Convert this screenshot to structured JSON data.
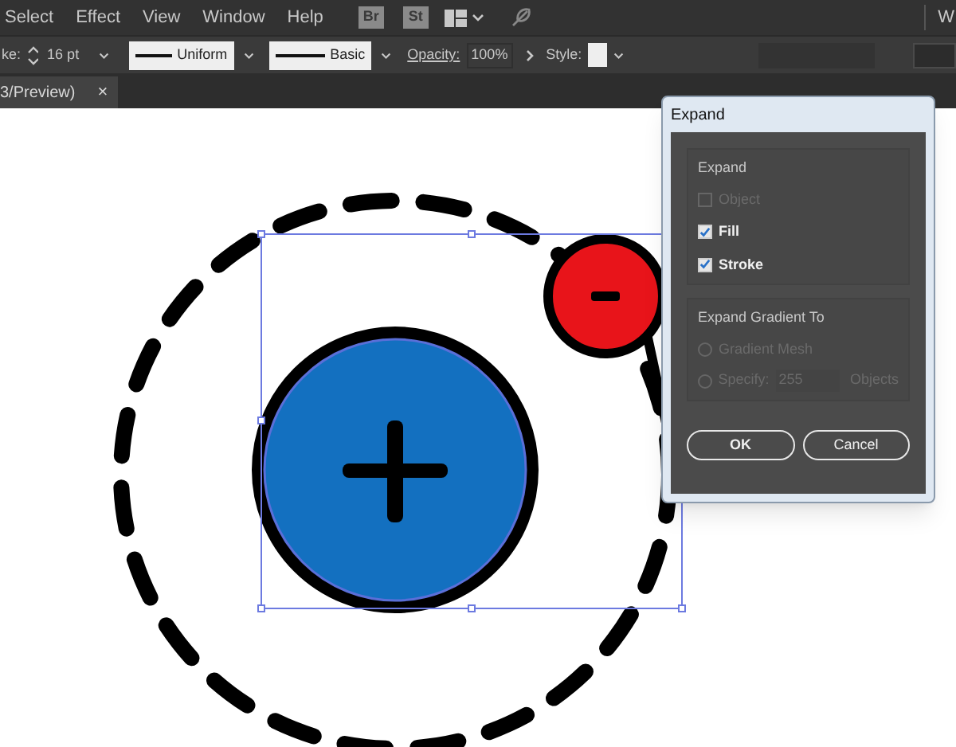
{
  "menu_bar": {
    "items": [
      {
        "label": "Select"
      },
      {
        "label": "Effect"
      },
      {
        "label": "View"
      },
      {
        "label": "Window"
      },
      {
        "label": "Help"
      }
    ],
    "app_badges": [
      "Br",
      "St"
    ],
    "cut_item": "W"
  },
  "control_bar": {
    "stroke_label": "ke:",
    "stroke_weight": "16 pt",
    "profile": "Uniform",
    "brush": "Basic",
    "opacity_label": "Opacity:",
    "opacity": "100%",
    "style_label": "Style:"
  },
  "document_tab": {
    "title": "3/Preview)",
    "close": "×"
  },
  "dialog": {
    "title": "Expand",
    "expand_group": {
      "title": "Expand",
      "options": [
        {
          "label": "Object",
          "checked": false,
          "disabled": true
        },
        {
          "label": "Fill",
          "checked": true,
          "disabled": false
        },
        {
          "label": "Stroke",
          "checked": true,
          "disabled": false
        }
      ]
    },
    "gradient_group": {
      "title": "Expand Gradient To",
      "options": [
        {
          "kind": "radio",
          "label": "Gradient Mesh",
          "selected": false,
          "disabled": true
        },
        {
          "kind": "specify",
          "label": "Specify:",
          "selected": false,
          "disabled": true,
          "value": "255",
          "unit": "Objects"
        }
      ]
    },
    "buttons": [
      "OK",
      "Cancel"
    ]
  }
}
